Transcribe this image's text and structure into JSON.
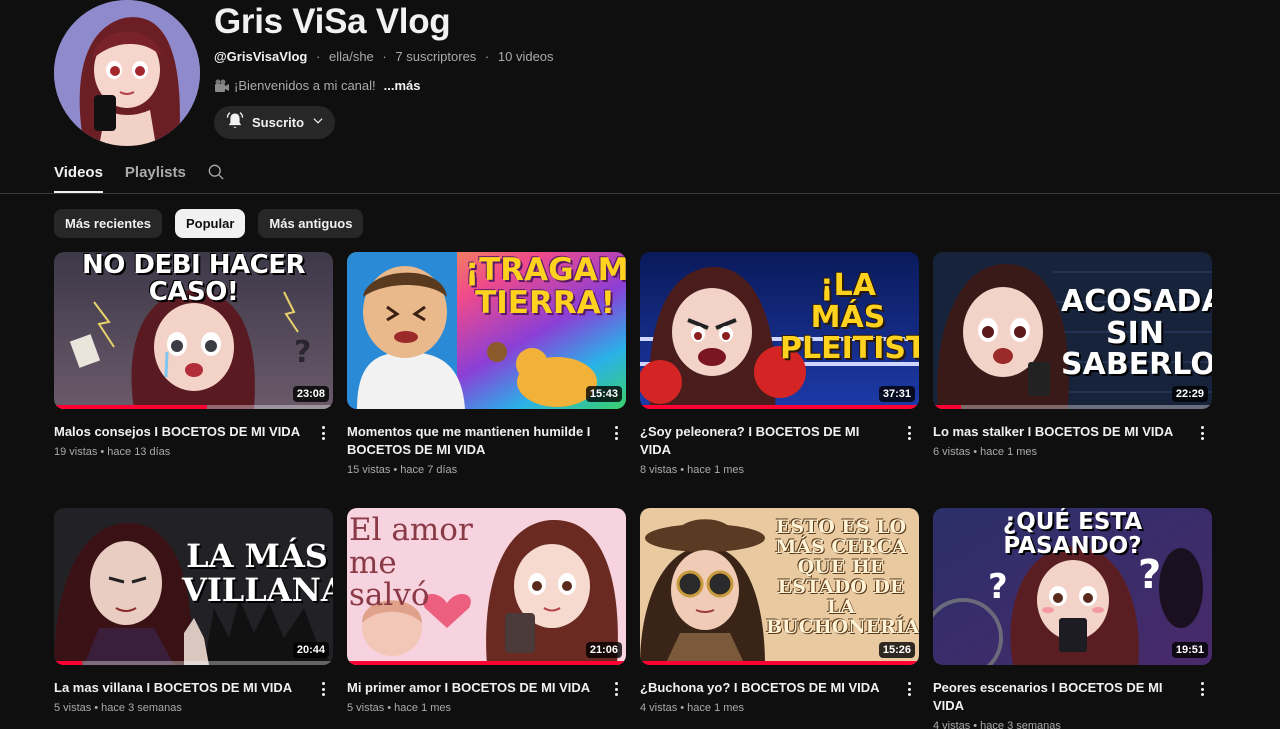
{
  "channel": {
    "title": "Gris ViSa Vlog",
    "handle": "@GrisVisaVlog",
    "pronouns": "ella/she",
    "subscribers": "7 suscriptores",
    "video_count": "10 videos",
    "description": "¡Bienvenidos a mi canal!",
    "more_label": "...más",
    "subscribe_label": "Suscrito"
  },
  "tabs": [
    {
      "label": "Videos",
      "active": true
    },
    {
      "label": "Playlists",
      "active": false
    }
  ],
  "chips": [
    {
      "label": "Más recientes",
      "selected": false
    },
    {
      "label": "Popular",
      "selected": true
    },
    {
      "label": "Más antiguos",
      "selected": false
    }
  ],
  "videos": [
    {
      "title": "Malos consejos I BOCETOS DE MI VIDA",
      "views": "19 vistas",
      "age": "hace 13 días",
      "duration": "23:08",
      "thumb_text": "NO DEBI HACER CASO!",
      "watched": 0.55
    },
    {
      "title": "Momentos que me mantienen humilde I BOCETOS DE MI VIDA",
      "views": "15 vistas",
      "age": "hace 7 días",
      "duration": "15:43",
      "thumb_text": "¡TRAGAME TIERRA!",
      "watched": 0.0
    },
    {
      "title": "¿Soy peleonera? I BOCETOS DE MI VIDA",
      "views": "8 vistas",
      "age": "hace 1 mes",
      "duration": "37:31",
      "thumb_text": "¡LA MÁS PLEITISTA!",
      "watched": 1.0
    },
    {
      "title": "Lo mas stalker I BOCETOS DE MI VIDA",
      "views": "6 vistas",
      "age": "hace 1 mes",
      "duration": "22:29",
      "thumb_text": "ACOSADA SIN SABERLO",
      "watched": 0.1
    },
    {
      "title": "La mas villana I BOCETOS DE MI VIDA",
      "views": "5 vistas",
      "age": "hace 3 semanas",
      "duration": "20:44",
      "thumb_text": "LA MÁS VILLANA",
      "watched": 0.1
    },
    {
      "title": "Mi primer amor I BOCETOS DE MI VIDA",
      "views": "5 vistas",
      "age": "hace 1 mes",
      "duration": "21:06",
      "thumb_text": "El amor me salvó",
      "watched": 1.0
    },
    {
      "title": "¿Buchona yo? I BOCETOS DE MI VIDA",
      "views": "4 vistas",
      "age": "hace 1 mes",
      "duration": "15:26",
      "thumb_text": "ESTO ES LO MÁS CERCA QUE HE ESTADO DE LA BUCHONERÍA",
      "watched": 1.0
    },
    {
      "title": "Peores escenarios I BOCETOS DE MI VIDA",
      "views": "4 vistas",
      "age": "hace 3 semanas",
      "duration": "19:51",
      "thumb_text": "¿QUÉ ESTA PASANDO?",
      "watched": 0.0
    }
  ],
  "icons": {
    "bell": "bell-icon",
    "chevron": "chevron-down-icon",
    "search": "search-icon",
    "camera": "movie-camera-icon",
    "more": "more-vert-icon"
  },
  "colors": {
    "background": "#0f0f0f",
    "progress": "#ff0033",
    "chip": "#272727",
    "chip_selected": "#f1f1f1"
  }
}
